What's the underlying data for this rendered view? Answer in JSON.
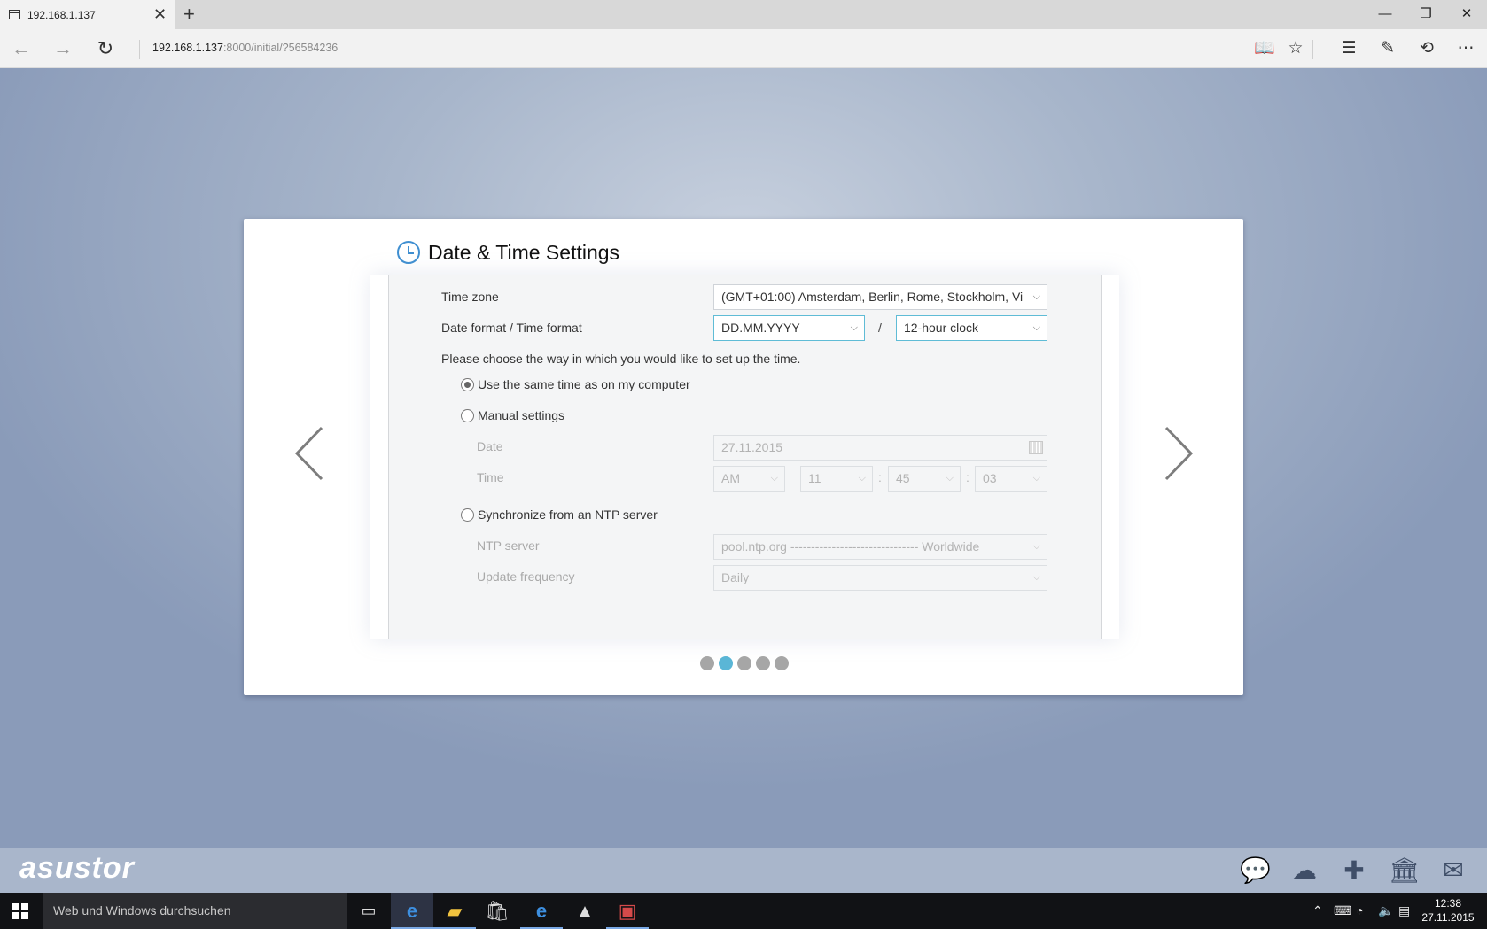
{
  "browser": {
    "tab_title": "192.168.1.137",
    "url_host": "192.168.1.137",
    "url_rest": ":8000/initial/?56584236"
  },
  "wizard": {
    "title": "Date & Time Settings",
    "time_zone_label": "Time zone",
    "time_zone_value": "(GMT+01:00) Amsterdam, Berlin, Rome, Stockholm, Vi",
    "format_label": "Date format / Time format",
    "date_format_value": "DD.MM.YYYY",
    "format_separator": "/",
    "time_format_value": "12-hour clock",
    "choose_prompt": "Please choose the way in which you would like to set up the time.",
    "option_same_time": "Use the same time as on my computer",
    "option_manual": "Manual settings",
    "date_label": "Date",
    "date_value": "27.11.2015",
    "time_label": "Time",
    "time_ampm": "AM",
    "time_hour": "11",
    "time_minute": "45",
    "time_second": "03",
    "time_colon": ":",
    "option_ntp": "Synchronize from an NTP server",
    "ntp_label": "NTP server",
    "ntp_value": "pool.ntp.org ------------------------------- Worldwide",
    "update_label": "Update frequency",
    "update_value": "Daily",
    "selected_option": "same_time",
    "steps_total": 5,
    "step_current": 2
  },
  "footer": {
    "logo": "asustor"
  },
  "taskbar": {
    "search_placeholder": "Web und Windows durchsuchen",
    "time": "12:38",
    "date": "27.11.2015"
  },
  "colors": {
    "accent": "#5ab6d6",
    "clock_icon": "#3f8fd1",
    "footer_bar": "#a9b6cb"
  }
}
